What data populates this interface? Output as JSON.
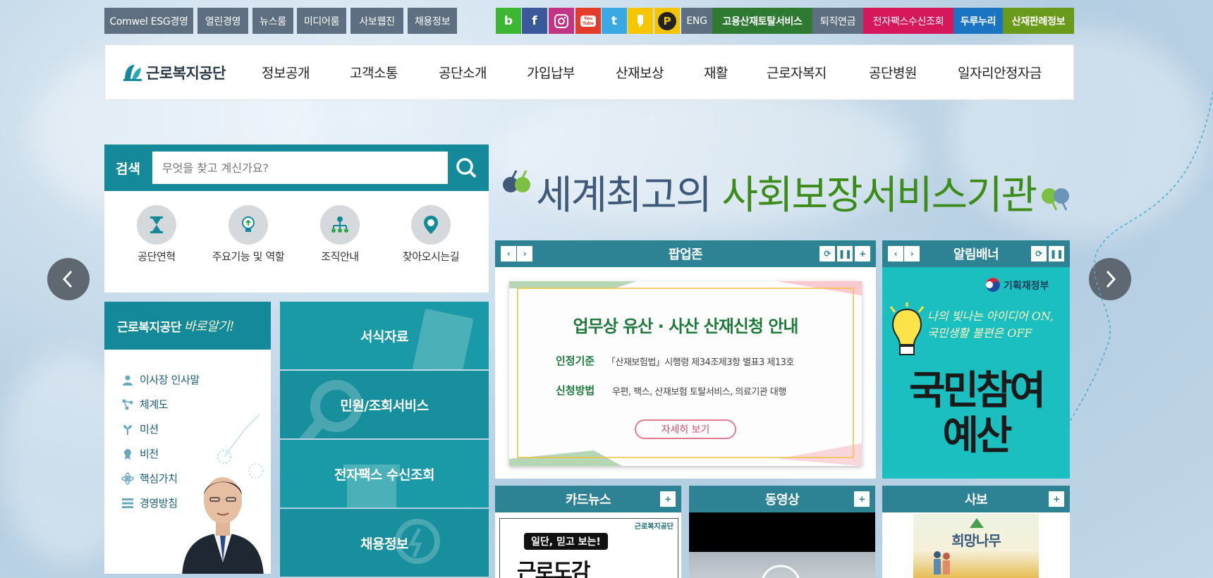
{
  "util_links": [
    "Comwel ESG경영",
    "열린경영",
    "뉴스룸",
    "미디어룸",
    "사보웹진",
    "채용정보"
  ],
  "sns": {
    "blog": {
      "label": "b",
      "color": "#3db634"
    },
    "facebook": {
      "label": "f",
      "color": "#3b5998"
    },
    "instagram": {
      "label": "◎",
      "color": "#c13584"
    },
    "youtube": {
      "label": "You Tube",
      "color": "#e43c2b"
    },
    "twitter": {
      "label": "t",
      "color": "#3aa9e3"
    },
    "kakao": {
      "label": "❜",
      "color": "#f6c700"
    },
    "post": {
      "label": "P",
      "color": "#f3c400"
    }
  },
  "lang_link": "ENG",
  "service_links": [
    {
      "label": "고용산재토탈서비스",
      "color": "#2f7a32"
    },
    {
      "label": "퇴직연금",
      "color": "#5e6f82"
    },
    {
      "label": "전자팩스수신조회",
      "color": "#d6185a"
    },
    {
      "label": "두루누리",
      "color": "#1a74c2"
    },
    {
      "label": "산재판례정보",
      "color": "#6a9a19"
    }
  ],
  "logo": {
    "text": "근로복지공단"
  },
  "menu": [
    "정보공개",
    "고객소통",
    "공단소개",
    "가입납부",
    "산재보상",
    "재활",
    "근로자복지",
    "공단병원",
    "일자리안정자금"
  ],
  "search": {
    "label": "검색",
    "placeholder": "무엇을 찾고 계신가요?"
  },
  "quick_links": [
    "공단연혁",
    "주요기능 및 역할",
    "조직안내",
    "찾아오시는길"
  ],
  "know": {
    "title": "근로복지공단",
    "title_script": "바로알기!",
    "items": [
      "이사장 인사말",
      "체계도",
      "미션",
      "비전",
      "핵심가치",
      "경영방침"
    ]
  },
  "tiles": [
    "서식자료",
    "민원/조회서비스",
    "전자팩스 수신조회",
    "채용정보"
  ],
  "slogan": {
    "part1": "세계최고의 ",
    "part2": "사회보장서비스기관",
    "color1": "#3f5a79",
    "color2": "#3c8c1a"
  },
  "popup_zone": {
    "title": "팝업존",
    "banner_title": "업무상 유산 · 사산 산재신청 안내",
    "row1_label": "인정기준",
    "row1_text": "「산재보험법」시행령 제34조제3항 별표3 제13호",
    "row2_label": "신청방법",
    "row2_text": "우편, 팩스, 산재보험 토탈서비스, 의료기관 대행",
    "button": "자세히 보기"
  },
  "alarm_banner": {
    "title": "알림배너",
    "ministry": "기획재정부",
    "tagline": "나의 빛나는 아이디어 ON, 국민생활 불편은 OFF",
    "headline1": "국민참여",
    "headline2": "예산"
  },
  "card_news": {
    "title": "카드뉴스",
    "brand": "근로복지공단",
    "caption": "일단, 믿고 보는!",
    "big": "근로도감"
  },
  "video": {
    "title": "동영상"
  },
  "magazine": {
    "title": "사보",
    "name": "희망나무"
  }
}
